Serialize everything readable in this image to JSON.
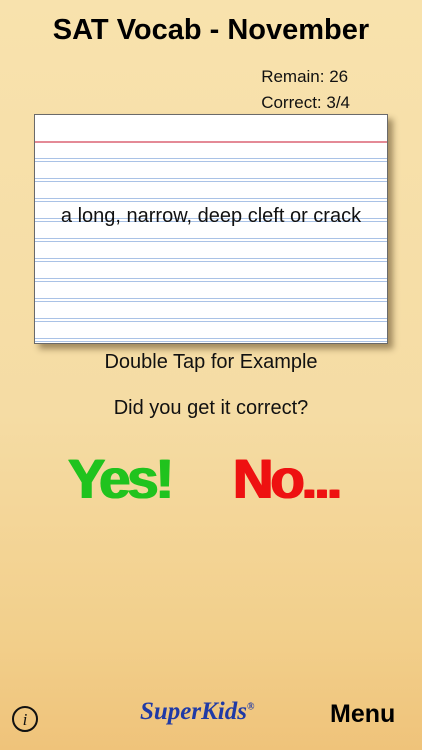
{
  "header": {
    "title": "SAT Vocab - November"
  },
  "stats": {
    "remain": "Remain: 26",
    "correct": "Correct:  3/4"
  },
  "card": {
    "definition": "a long, narrow, deep cleft or crack"
  },
  "prompts": {
    "hint": "Double Tap for Example",
    "question": "Did you get it correct?"
  },
  "answers": {
    "yes_label": "Yes!",
    "no_label": "No..."
  },
  "footer": {
    "info_glyph": "i",
    "info_icon": "info-circle-icon",
    "brand_name": "SuperKids",
    "brand_mark": "®",
    "menu_label": "Menu"
  },
  "colors": {
    "background": "#f5dca4",
    "yes": "#20c31e",
    "no": "#ee1111",
    "brand": "#1f3aa6",
    "card_red_line": "#e48a96",
    "card_blue_lines": "#a9c2e6"
  }
}
